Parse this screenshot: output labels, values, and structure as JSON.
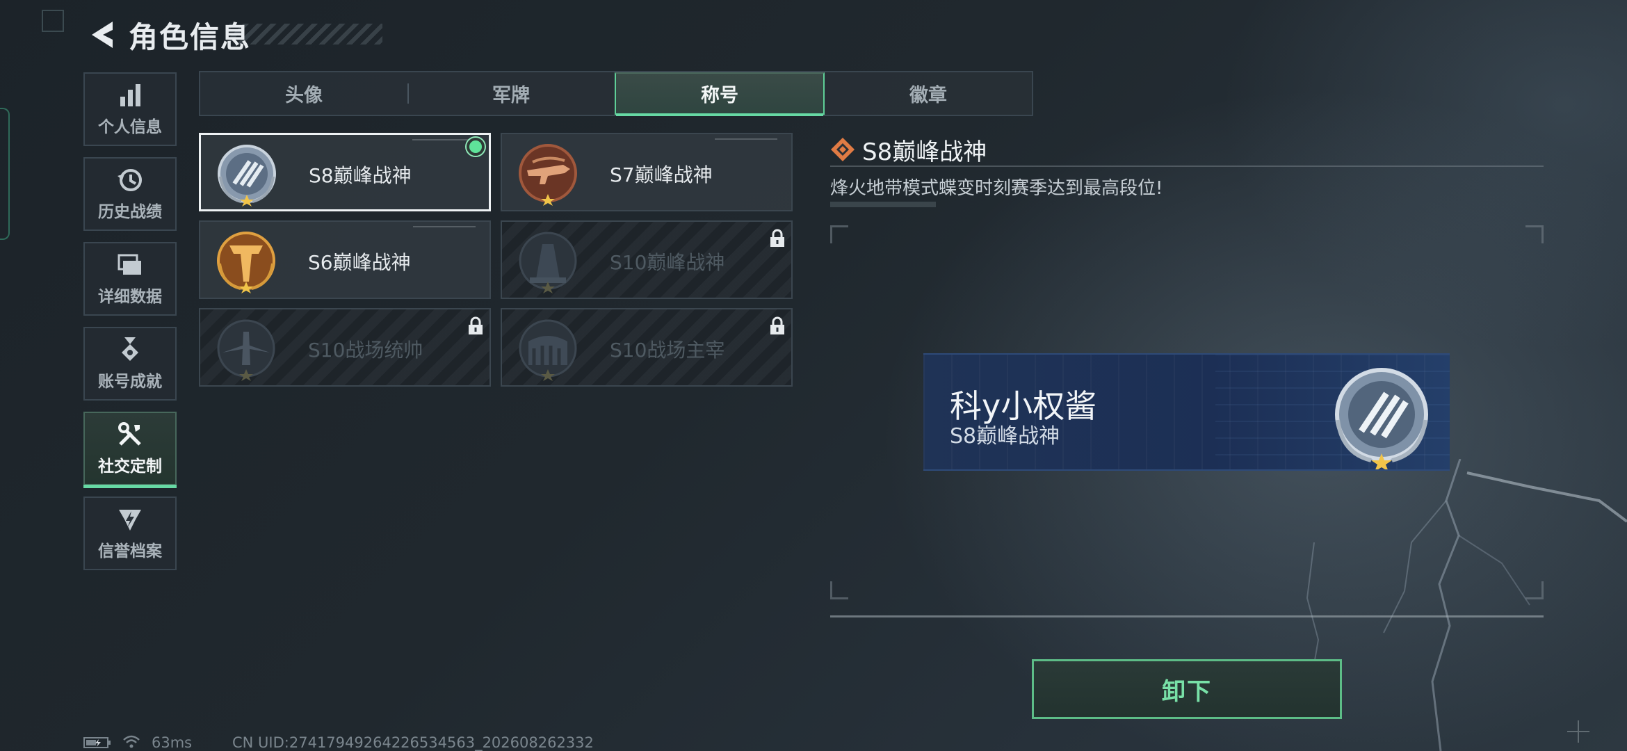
{
  "header": {
    "title": "角色信息"
  },
  "sidebar": {
    "items": [
      {
        "label": "个人信息",
        "icon": "bar-chart-icon",
        "active": false
      },
      {
        "label": "历史战绩",
        "icon": "history-clock-icon",
        "active": false
      },
      {
        "label": "详细数据",
        "icon": "folder-stack-icon",
        "active": false
      },
      {
        "label": "账号成就",
        "icon": "medal-icon",
        "active": false
      },
      {
        "label": "社交定制",
        "icon": "tools-icon",
        "active": true
      },
      {
        "label": "信誉档案",
        "icon": "shield-lightning-icon",
        "active": false
      }
    ]
  },
  "tabs": [
    {
      "label": "头像",
      "active": false
    },
    {
      "label": "军牌",
      "active": false
    },
    {
      "label": "称号",
      "active": true
    },
    {
      "label": "徽章",
      "active": false
    }
  ],
  "titles": [
    {
      "name": "S8巅峰战神",
      "emblem": "silver-wings-emblem",
      "locked": false,
      "selected": true,
      "equipped": true
    },
    {
      "name": "S7巅峰战神",
      "emblem": "bronze-gun-emblem",
      "locked": false,
      "selected": false,
      "equipped": false
    },
    {
      "name": "S6巅峰战神",
      "emblem": "gold-t-emblem",
      "locked": false,
      "selected": false,
      "equipped": false
    },
    {
      "name": "S10巅峰战神",
      "emblem": "dark-tower-emblem",
      "locked": true,
      "selected": false,
      "equipped": false
    },
    {
      "name": "S10战场统帅",
      "emblem": "dark-aircraft-emblem",
      "locked": true,
      "selected": false,
      "equipped": false
    },
    {
      "name": "S10战场主宰",
      "emblem": "dark-colosseum-emblem",
      "locked": true,
      "selected": false,
      "equipped": false
    }
  ],
  "detail": {
    "title": "S8巅峰战神",
    "description": "烽火地带模式蝶变时刻赛季达到最高段位!"
  },
  "preview": {
    "player_name": "科y小权酱",
    "title": "S8巅峰战神"
  },
  "actions": {
    "unequip_label": "卸下"
  },
  "status": {
    "ping": "63ms",
    "uid": "CN UID:274179492642265345​63_202608262332"
  },
  "colors": {
    "accent_green": "#67d9a4",
    "banner_blue": "#1f3356",
    "card_bg": "#343c43"
  }
}
